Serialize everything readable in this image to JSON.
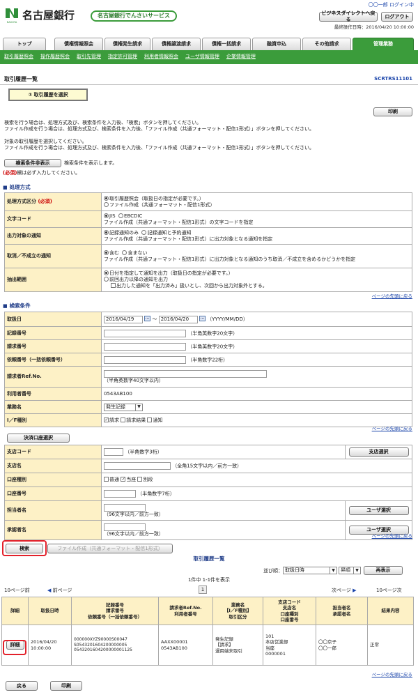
{
  "header": {
    "bank_name": "名古屋銀行",
    "service_name": "名古屋銀行でんさいサービス",
    "user_name": "〇〇一郎 ログイン中",
    "direct_button": "ビジネスダイレクトへ戻る",
    "logout_button": "ログアウト",
    "last_operation": "最終操作日時：2016/04/20 10:00:00"
  },
  "tabs": [
    {
      "label": "トップ"
    },
    {
      "label": "債権情報照会"
    },
    {
      "label": "債権発生請求"
    },
    {
      "label": "債権譲渡請求"
    },
    {
      "label": "債権一括請求"
    },
    {
      "label": "融資申込"
    },
    {
      "label": "その他請求"
    },
    {
      "label": "管理業務"
    }
  ],
  "subnav": [
    "取引履歴照会",
    "操作履歴照会",
    "取引先管理",
    "指定許可管理",
    "利用者情報照会",
    "ユーザ情報管理",
    "企業情報管理"
  ],
  "page": {
    "title": "取引履歴一覧",
    "screen_id": "SCRTRS11101",
    "step_label": "① 取引履歴を選択",
    "print_button": "印刷"
  },
  "instructions": [
    "検索を行う場合は、処理方式及び、検索条件を入力後、「検索」ボタンを押してください。",
    "ファイル作成を行う場合は、処理方式及び、検索条件を入力後、「ファイル作成（共通フォーマット・配信1形式）」ボタンを押してください。",
    "",
    "対象の取引履歴を選択してください。",
    "ファイル作成を行う場合は、処理方式及び、検索条件を入力後、「ファイル作成（共通フォーマット・配信1形式）」ボタンを押してください。"
  ],
  "toggle_button": "検索条件非表示",
  "toggle_note": "検索条件を表示します。",
  "required_note_tag": "(必須)",
  "required_note": "欄は必ず入力してください。",
  "processing": {
    "title": "処理方式",
    "rows": [
      {
        "label": "処理方式区分",
        "required": "(必須)",
        "options": [
          {
            "text": "取引履歴照会（取扱日の指定が必要です。）",
            "on": true
          },
          {
            "text": "ファイル作成（共通フォーマット・配信1形式）",
            "on": false
          }
        ]
      },
      {
        "label": "文字コード",
        "options": [
          {
            "text": "JIS",
            "on": true
          },
          {
            "text": "EBCDIC",
            "on": false
          }
        ],
        "note": "ファイル作成（共通フォーマット・配信1形式）の文字コードを指定"
      },
      {
        "label": "出力対象の通知",
        "options": [
          {
            "text": "記録通知のみ",
            "on": true
          },
          {
            "text": "記録通知と予約通知",
            "on": false
          }
        ],
        "note": "ファイル作成（共通フォーマット・配信1形式）に出力対象となる通知を指定"
      },
      {
        "label": "取消／不成立の通知",
        "options": [
          {
            "text": "含む",
            "on": true
          },
          {
            "text": "含まない",
            "on": false
          }
        ],
        "note": "ファイル作成（共通フォーマット・配信1形式）に出力対象となる通知のうち取消／不成立を含めるかどうかを指定"
      },
      {
        "label": "抽出範囲",
        "options": [
          {
            "text": "日付を指定して通知を出力（取扱日の指定が必要です。）",
            "on": true
          },
          {
            "text": "前回出力以降の通知を出力",
            "on": false
          }
        ],
        "check": "出力した通知を「出力済み」扱いとし、次回から出力対象外とする。"
      }
    ]
  },
  "to_top": "ページの先頭に戻る",
  "search": {
    "title": "検索条件",
    "date_label": "取扱日",
    "date_from": "2016/04/19",
    "date_to": "2016/04/20",
    "date_sep": "～",
    "date_fmt": "（YYYY/MM/DD）",
    "rows": [
      {
        "label": "記録番号",
        "hint": "（半角英数字20文字）"
      },
      {
        "label": "請求番号",
        "hint": "（半角英数字20文字）"
      },
      {
        "label": "依頼番号（一括依頼番号）",
        "hint": "（半角数字22桁）"
      },
      {
        "label": "請求者Ref.No.",
        "hint": "（半角英数字40文字以内）"
      }
    ],
    "user_no_label": "利用者番号",
    "user_no": "0543AB100",
    "record_type_label": "業務名",
    "record_type": "発生記録",
    "if_label": "I／F種別",
    "if_options": [
      {
        "text": "請求",
        "on": true
      },
      {
        "text": "請求結果",
        "on": false
      },
      {
        "text": "通知",
        "on": false
      }
    ]
  },
  "account": {
    "select_button": "決済口座選択",
    "branch_code_label": "支店コード",
    "branch_code_hint": "（半角数字3桁）",
    "branch_select": "支店選択",
    "branch_name_label": "支店名",
    "branch_name_hint": "（全角15文字以内／前方一致）",
    "acct_type_label": "口座種別",
    "acct_types": [
      {
        "text": "普通",
        "on": false
      },
      {
        "text": "当座",
        "on": true
      },
      {
        "text": "別段",
        "on": false
      }
    ],
    "acct_no_label": "口座番号",
    "acct_no_hint": "（半角数字7桁）",
    "rep_label": "担当者名",
    "rep_hint": "（96文字以内／前方一致）",
    "user_select": "ユーザ選択",
    "appr_label": "承認者名",
    "appr_hint": "（96文字以内／前方一致）",
    "user_select2": "ユーザ選択"
  },
  "actions": {
    "search_button": "検索",
    "file_button": "ファイル作成（共通フォーマット・配信1形式）"
  },
  "results": {
    "title": "取引履歴一覧",
    "sort_label": "並び順：",
    "sort_field": "取扱日時",
    "sort_dir": "昇順",
    "resort_button": "再表示",
    "count": "1件中 1-1件を表示",
    "prev10": "10ページ前",
    "prev": "前ページ",
    "page": "1",
    "next": "次ページ",
    "next10": "10ページ次",
    "headers": [
      "詳細",
      "取扱日時",
      "記録番号\n請求番号\n依頼番号（一括依頼番号）",
      "請求者Ref.No.\n利用者番号",
      "業務名\n【I／F種別】\n取引区分",
      "支店コード\n支店名\n口座種別\n口座番号",
      "担当者名\n承認者名",
      "結果内容"
    ],
    "rows": [
      {
        "detail": "詳細",
        "date": "2016/04/20\n10:00:00",
        "numbers": "000000XYZ90000S00047\nS0543201604200000005\n0543201604200000001125",
        "ref": "AAXX00001\n0543AB100",
        "biz": "発生記録\n【請求】\n運用端末取引",
        "branch": "101\n本店営業部\n当座\n0000001",
        "people": "〇〇京子\n〇〇一郎",
        "result": "正常"
      }
    ]
  },
  "footer": {
    "back_button": "戻る",
    "print_button": "印刷"
  },
  "colors": {
    "accent": "#3b9c3b",
    "label_bg": "#fdf1c6",
    "highlight": "#e3202a",
    "nav_link": "#1a44aa"
  }
}
